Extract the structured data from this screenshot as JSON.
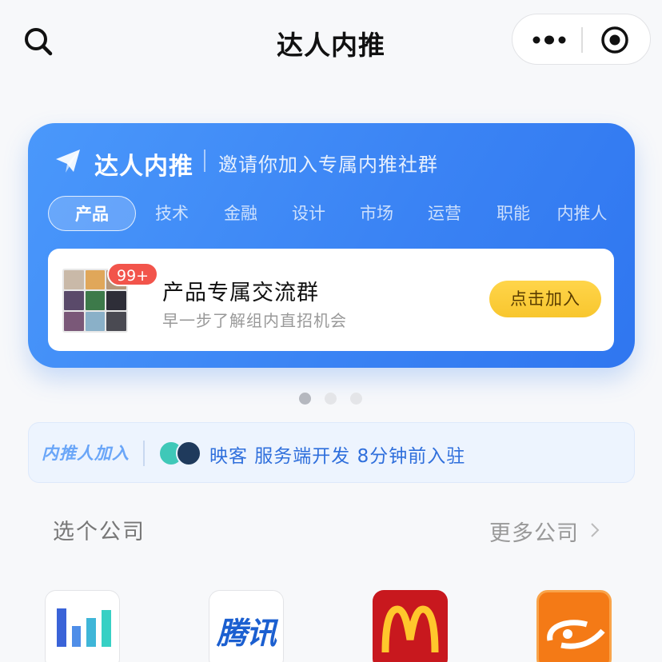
{
  "navbar": {
    "title": "达人内推",
    "search_icon": "search-icon",
    "more_icon": "more-dots-icon",
    "close_icon": "target-close-icon"
  },
  "banner": {
    "title": "达人内推",
    "subtitle": "邀请你加入专属内推社群",
    "icon": "paper-plane-icon",
    "tabs": [
      "产品",
      "技术",
      "金融",
      "设计",
      "市场",
      "运营",
      "职能",
      "内推人"
    ],
    "active_tab": 0,
    "group": {
      "badge": "99+",
      "title": "产品专属交流群",
      "subtitle": "早一步了解组内直招机会",
      "join_label": "点击加入"
    },
    "colors": {
      "gradient_start": "#4a98fb",
      "gradient_end": "#2f76f0",
      "join_button": "#f8c62e"
    }
  },
  "carousel": {
    "pages": 3,
    "active": 0
  },
  "notice": {
    "label": "内推人加入",
    "message": "映客 服务端开发 8分钟前入驻"
  },
  "companies_section": {
    "title": "选个公司",
    "more": "更多公司",
    "chevron_icon": "chevron-right-icon",
    "companies": [
      {
        "name": "bars-logo",
        "icon": "bar-chart-logo"
      },
      {
        "name": "腾讯",
        "icon": "tencent-logo"
      },
      {
        "name": "mcdonalds",
        "icon": "mcdonalds-arches-logo"
      },
      {
        "name": "alibaba",
        "icon": "alibaba-logo"
      }
    ]
  }
}
